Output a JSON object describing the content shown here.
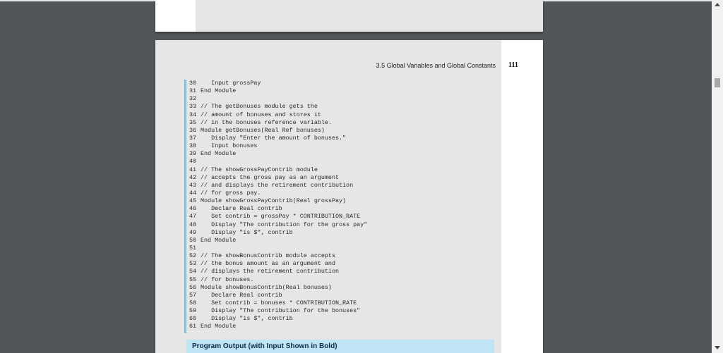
{
  "document": {
    "header_title": "3.5 Global Variables and Global Constants",
    "page_number": "111",
    "code_lines": [
      {
        "num": "30",
        "text": "   Input grossPay"
      },
      {
        "num": "31",
        "text": "End Module"
      },
      {
        "num": "32",
        "text": ""
      },
      {
        "num": "33",
        "text": "// The getBonuses module gets the"
      },
      {
        "num": "34",
        "text": "// amount of bonuses and stores it"
      },
      {
        "num": "35",
        "text": "// in the bonuses reference variable."
      },
      {
        "num": "36",
        "text": "Module getBonuses(Real Ref bonuses)"
      },
      {
        "num": "37",
        "text": "   Display \"Enter the amount of bonuses.\""
      },
      {
        "num": "38",
        "text": "   Input bonuses"
      },
      {
        "num": "39",
        "text": "End Module"
      },
      {
        "num": "40",
        "text": ""
      },
      {
        "num": "41",
        "text": "// The showGrossPayContrib module"
      },
      {
        "num": "42",
        "text": "// accepts the gross pay as an argument"
      },
      {
        "num": "43",
        "text": "// and displays the retirement contribution"
      },
      {
        "num": "44",
        "text": "// for gross pay."
      },
      {
        "num": "45",
        "text": "Module showGrossPayContrib(Real grossPay)"
      },
      {
        "num": "46",
        "text": "   Declare Real contrib"
      },
      {
        "num": "47",
        "text": "   Set contrib = grossPay * CONTRIBUTION_RATE"
      },
      {
        "num": "48",
        "text": "   Display \"The contribution for the gross pay\""
      },
      {
        "num": "49",
        "text": "   Display \"is $\", contrib"
      },
      {
        "num": "50",
        "text": "End Module"
      },
      {
        "num": "51",
        "text": ""
      },
      {
        "num": "52",
        "text": "// The showBonusContrib module accepts"
      },
      {
        "num": "53",
        "text": "// the bonus amount as an argument and"
      },
      {
        "num": "54",
        "text": "// displays the retirement contribution"
      },
      {
        "num": "55",
        "text": "// for bonuses."
      },
      {
        "num": "56",
        "text": "Module showBonusContrib(Real bonuses)"
      },
      {
        "num": "57",
        "text": "   Declare Real contrib"
      },
      {
        "num": "58",
        "text": "   Set contrib = bonuses * CONTRIBUTION_RATE"
      },
      {
        "num": "59",
        "text": "   Display \"The contribution for the bonuses\""
      },
      {
        "num": "60",
        "text": "   Display \"is $\", contrib"
      },
      {
        "num": "61",
        "text": "End Module"
      }
    ],
    "output_title": "Program Output (with Input Shown in Bold)"
  },
  "viewer": {
    "background_color": "#525659",
    "page_color": "#e6e6e6",
    "code_bar_color": "#78bfe0",
    "output_bar_color": "#bfe5f5",
    "scrollbar": {
      "up_icon": "scroll-up-arrow-icon",
      "down_icon": "scroll-down-arrow-icon"
    }
  }
}
